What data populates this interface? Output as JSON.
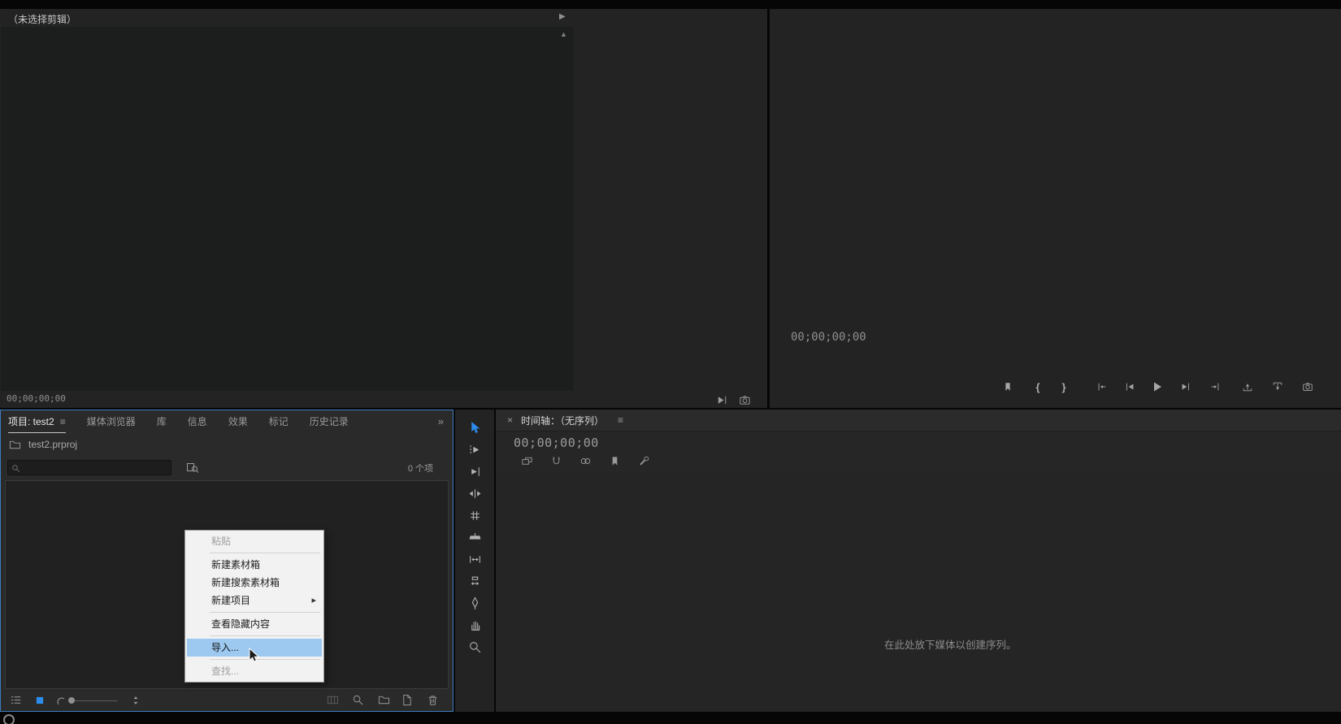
{
  "glyphs": {
    "panel_menu": "≡",
    "tab_overflow": "»",
    "close": "×",
    "header_next": "▶",
    "scroll_up": "▲",
    "mark_in": "{",
    "mark_out": "}",
    "submenu_arrow": "▸"
  },
  "source_monitor": {
    "title": "（未选择剪辑）",
    "timecode": "00;00;00;00"
  },
  "program_monitor": {
    "timecode": "00;00;00;00"
  },
  "project_panel": {
    "tabs": [
      "项目: test2",
      "媒体浏览器",
      "库",
      "信息",
      "效果",
      "标记",
      "历史记录"
    ],
    "breadcrumb": "test2.prproj",
    "search_value": "",
    "item_count": "0 个项"
  },
  "timeline_panel": {
    "title": "时间轴：（无序列）",
    "timecode": "00;00;00;00",
    "empty_message": "在此处放下媒体以创建序列。"
  },
  "context_menu": {
    "items": [
      {
        "label": "粘贴",
        "state": "disabled"
      },
      {
        "label": "新建素材箱",
        "state": "normal"
      },
      {
        "label": "新建搜索素材箱",
        "state": "normal"
      },
      {
        "label": "新建项目",
        "state": "normal",
        "has_submenu": true
      },
      {
        "label": "查看隐藏内容",
        "state": "normal"
      },
      {
        "label": "导入...",
        "state": "highlighted"
      },
      {
        "label": "查找...",
        "state": "disabled"
      }
    ]
  },
  "colors": {
    "focus_border": "#3d7dbe",
    "tool_active": "#2d8ceb",
    "menu_highlight": "#9dc9f0"
  }
}
